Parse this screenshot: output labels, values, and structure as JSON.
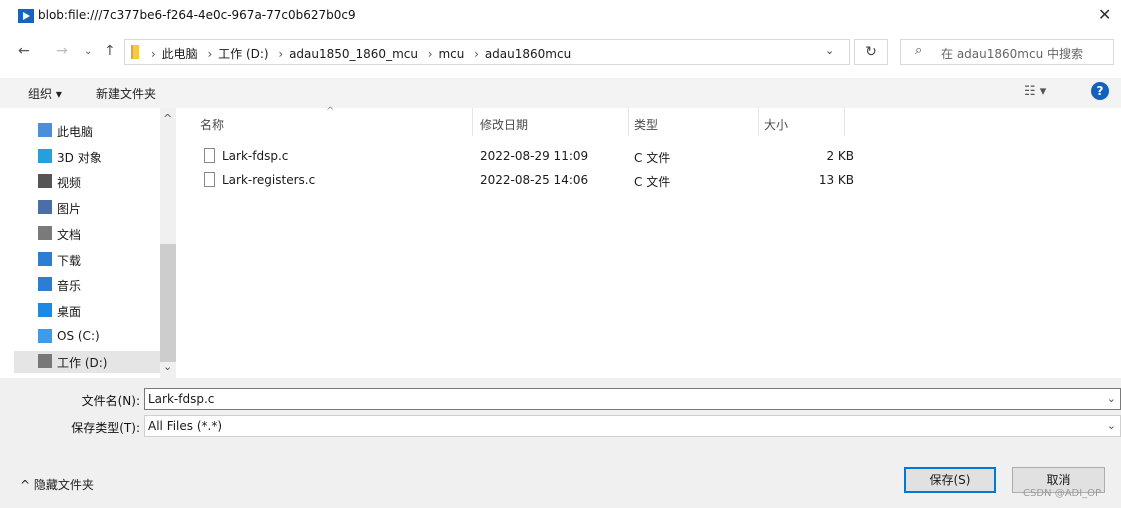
{
  "window": {
    "title": "blob:file:///7c377be6-f264-4e0c-967a-77c0b627b0c9",
    "close_label": "✕"
  },
  "address": {
    "crumbs": [
      "此电脑",
      "工作 (D:)",
      "adau1850_1860_mcu",
      "mcu",
      "adau1860mcu"
    ],
    "search_placeholder": "在 adau1860mcu 中搜索"
  },
  "toolbar": {
    "organize_label": "组织 ▾",
    "new_folder_label": "新建文件夹"
  },
  "nav": {
    "items": [
      {
        "label": "此电脑",
        "icon": "computer-icon",
        "color": "#4a90d9"
      },
      {
        "label": "3D 对象",
        "icon": "cube-icon",
        "color": "#26a0da"
      },
      {
        "label": "视频",
        "icon": "film-icon",
        "color": "#555555"
      },
      {
        "label": "图片",
        "icon": "picture-icon",
        "color": "#4a6fa5"
      },
      {
        "label": "文档",
        "icon": "document-icon",
        "color": "#7a7a7a"
      },
      {
        "label": "下载",
        "icon": "download-icon",
        "color": "#2d7dd2"
      },
      {
        "label": "音乐",
        "icon": "music-icon",
        "color": "#2d7dd2"
      },
      {
        "label": "桌面",
        "icon": "desktop-icon",
        "color": "#1e88e5"
      },
      {
        "label": "OS (C:)",
        "icon": "os-drive-icon",
        "color": "#3d9be9"
      },
      {
        "label": "工作 (D:)",
        "icon": "drive-icon",
        "color": "#777777"
      }
    ]
  },
  "columns": {
    "name": "名称",
    "date": "修改日期",
    "type": "类型",
    "size": "大小"
  },
  "files": [
    {
      "name": "Lark-fdsp.c",
      "date": "2022-08-29 11:09",
      "type": "C 文件",
      "size": "2 KB"
    },
    {
      "name": "Lark-registers.c",
      "date": "2022-08-25 14:06",
      "type": "C 文件",
      "size": "13 KB"
    }
  ],
  "form": {
    "filename_label": "文件名(N):",
    "filename_value": "Lark-fdsp.c",
    "filetype_label": "保存类型(T):",
    "filetype_value": "All Files (*.*)"
  },
  "footer": {
    "hide_folders_label": "^ 隐藏文件夹",
    "save_label": "保存(S)",
    "cancel_label": "取消",
    "watermark": "CSDN @ADI_OP"
  },
  "colors": {
    "accent": "#0078d7",
    "help": "#1560bd",
    "selection": "#e5e5e5"
  }
}
